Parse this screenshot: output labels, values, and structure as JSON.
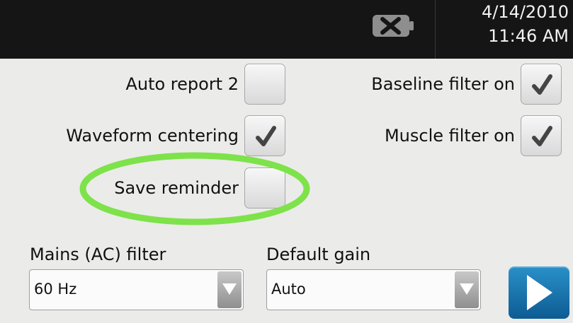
{
  "header": {
    "date": "4/14/2010",
    "time": "11:46 AM",
    "battery_icon": "battery-empty-icon"
  },
  "options": {
    "auto_report_2": {
      "label": "Auto report 2",
      "checked": false
    },
    "baseline_filter": {
      "label": "Baseline filter on",
      "checked": true
    },
    "waveform_centering": {
      "label": "Waveform centering",
      "checked": true
    },
    "muscle_filter": {
      "label": "Muscle filter on",
      "checked": true
    },
    "save_reminder": {
      "label": "Save reminder",
      "checked": false
    }
  },
  "mains_filter": {
    "label": "Mains (AC) filter",
    "value": "60 Hz"
  },
  "default_gain": {
    "label": "Default gain",
    "value": "Auto"
  },
  "colors": {
    "highlight": "#7ee24a",
    "next_button": "#1677b0"
  }
}
